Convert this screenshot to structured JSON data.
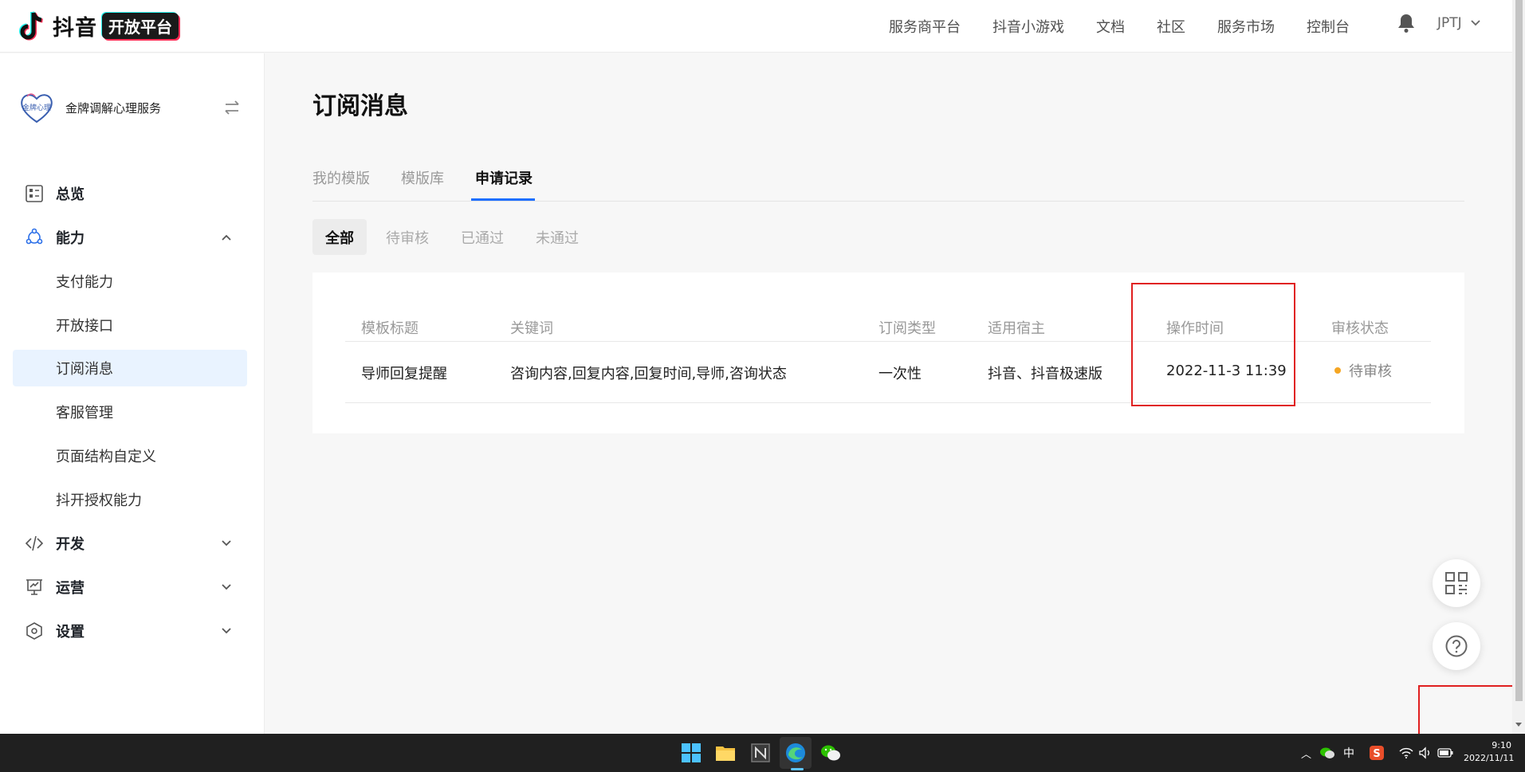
{
  "brand": {
    "name": "抖音",
    "badge": "开放平台"
  },
  "topnav": {
    "items": [
      "服务商平台",
      "抖音小游戏",
      "文档",
      "社区",
      "服务市场",
      "控制台"
    ],
    "user": "JPTJ"
  },
  "sidebar": {
    "app_name": "金牌调解心理服务",
    "app_avatar_text": "金牌心理",
    "menu": {
      "overview": "总览",
      "ability": "能力",
      "ability_sub": [
        "支付能力",
        "开放接口",
        "订阅消息",
        "客服管理",
        "页面结构自定义",
        "抖开授权能力"
      ],
      "develop": "开发",
      "operate": "运营",
      "settings": "设置"
    }
  },
  "main": {
    "title": "订阅消息",
    "tabs": [
      "我的模版",
      "模版库",
      "申请记录"
    ],
    "filters": [
      "全部",
      "待审核",
      "已通过",
      "未通过"
    ],
    "table": {
      "headers": [
        "模板标题",
        "关键词",
        "订阅类型",
        "适用宿主",
        "操作时间",
        "审核状态"
      ],
      "rows": [
        {
          "title": "导师回复提醒",
          "keywords": "咨询内容,回复内容,回复时间,导师,咨询状态",
          "type": "一次性",
          "host": "抖音、抖音极速版",
          "time": "2022-11-3 11:39",
          "status": "待审核"
        }
      ]
    }
  },
  "taskbar": {
    "ime": "中",
    "time": "9:10",
    "date": "2022/11/11"
  },
  "colors": {
    "accent": "#1e6fff",
    "highlight": "#e02020",
    "pending": "#f5a623"
  }
}
